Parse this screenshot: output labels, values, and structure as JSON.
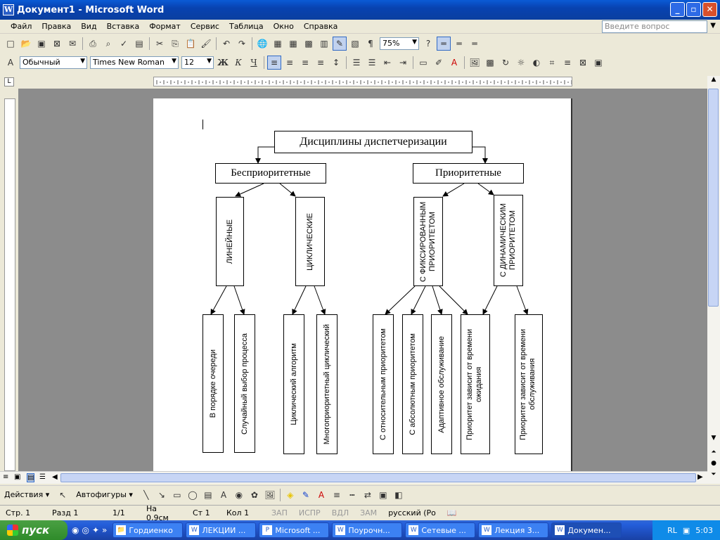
{
  "window": {
    "title": "Документ1 - Microsoft Word",
    "min": "_",
    "max": "▫",
    "close": "✕"
  },
  "menu": [
    "Файл",
    "Правка",
    "Вид",
    "Вставка",
    "Формат",
    "Сервис",
    "Таблица",
    "Окно",
    "Справка"
  ],
  "ask_placeholder": "Введите вопрос",
  "toolbar": {
    "zoom": "75%"
  },
  "format": {
    "style": "Обычный",
    "font": "Times New Roman",
    "size": "12",
    "bold": "Ж",
    "italic": "К",
    "underline": "Ч"
  },
  "diagram": {
    "root": "Дисциплины диспетчеризации",
    "l1": [
      "Бесприоритетные",
      "Приоритетные"
    ],
    "l2": [
      "ЛИНЕЙНЫЕ",
      "ЦИКЛИЧЕСКИЕ",
      "С ФИКСИРОВАННЫМ ПРИОРИТЕТОМ",
      "С ДИНАМИЧЕСКИМ ПРИОРИТЕТОМ"
    ],
    "l3": [
      "В порядке очереди",
      "Случайный выбор процесса",
      "Циклический алгоритм",
      "Многоприоритетный циклический",
      "С относительным приоритетом",
      "С абсолютным приоритетом",
      "Адаптивное обслуживание",
      "Приоритет зависит от времени ожидания",
      "Приоритет зависит от времени обслуживания"
    ]
  },
  "drawbar": {
    "actions": "Действия ▾",
    "autoshapes": "Автофигуры ▾"
  },
  "status": {
    "page": "Стр. 1",
    "section": "Разд 1",
    "pages": "1/1",
    "at": "На 0,9см",
    "line": "Ст 1",
    "col": "Кол 1",
    "rec": "ЗАП",
    "trk": "ИСПР",
    "ext": "ВДЛ",
    "ovr": "ЗАМ",
    "lang": "русский (Ро"
  },
  "taskbar": {
    "start": "пуск",
    "tasks": [
      "Гордиенко",
      "ЛЕКЦИИ ...",
      "Microsoft ...",
      "Поурочн...",
      "Сетевые ...",
      "Лекция 3...",
      "Докумен..."
    ],
    "lang": "RL",
    "clock": "5:03"
  }
}
